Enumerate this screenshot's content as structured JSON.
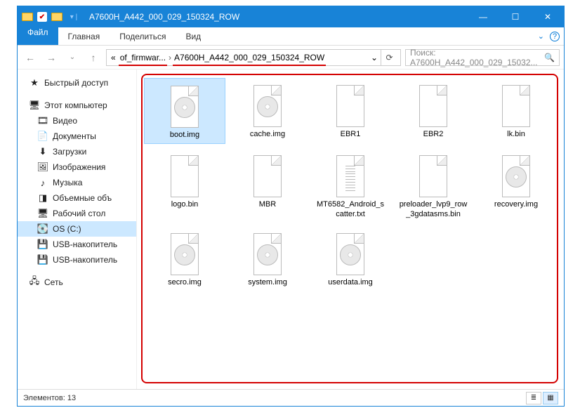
{
  "titlebar": {
    "title": "A7600H_A442_000_029_150324_ROW"
  },
  "ribbon": {
    "file": "Файл",
    "home": "Главная",
    "share": "Поделиться",
    "view": "Вид"
  },
  "breadcrumb": {
    "ellipsis": "«",
    "part1": "of_firmwar...",
    "sep": "›",
    "part2": "A7600H_A442_000_029_150324_ROW",
    "chev": "⌄"
  },
  "search": {
    "placeholder": "Поиск: A7600H_A442_000_029_15032..."
  },
  "sidebar": {
    "quick": "Быстрый доступ",
    "thispc": "Этот компьютер",
    "video": "Видео",
    "docs": "Документы",
    "downloads": "Загрузки",
    "pictures": "Изображения",
    "music": "Музыка",
    "volumes": "Объемные объ",
    "desktop": "Рабочий стол",
    "osc": "OS (C:)",
    "usb1": "USB-накопитель",
    "usb2": "USB-накопитель",
    "network": "Сеть"
  },
  "files": [
    {
      "name": "boot.img",
      "type": "disc",
      "selected": true
    },
    {
      "name": "cache.img",
      "type": "disc"
    },
    {
      "name": "EBR1",
      "type": "blank"
    },
    {
      "name": "EBR2",
      "type": "blank"
    },
    {
      "name": "lk.bin",
      "type": "blank"
    },
    {
      "name": "logo.bin",
      "type": "blank"
    },
    {
      "name": "MBR",
      "type": "blank"
    },
    {
      "name": "MT6582_Android_scatter.txt",
      "type": "text"
    },
    {
      "name": "preloader_lvp9_row_3gdatasms.bin",
      "type": "blank"
    },
    {
      "name": "recovery.img",
      "type": "disc"
    },
    {
      "name": "secro.img",
      "type": "disc"
    },
    {
      "name": "system.img",
      "type": "disc"
    },
    {
      "name": "userdata.img",
      "type": "disc"
    }
  ],
  "status": {
    "count": "Элементов: 13"
  }
}
